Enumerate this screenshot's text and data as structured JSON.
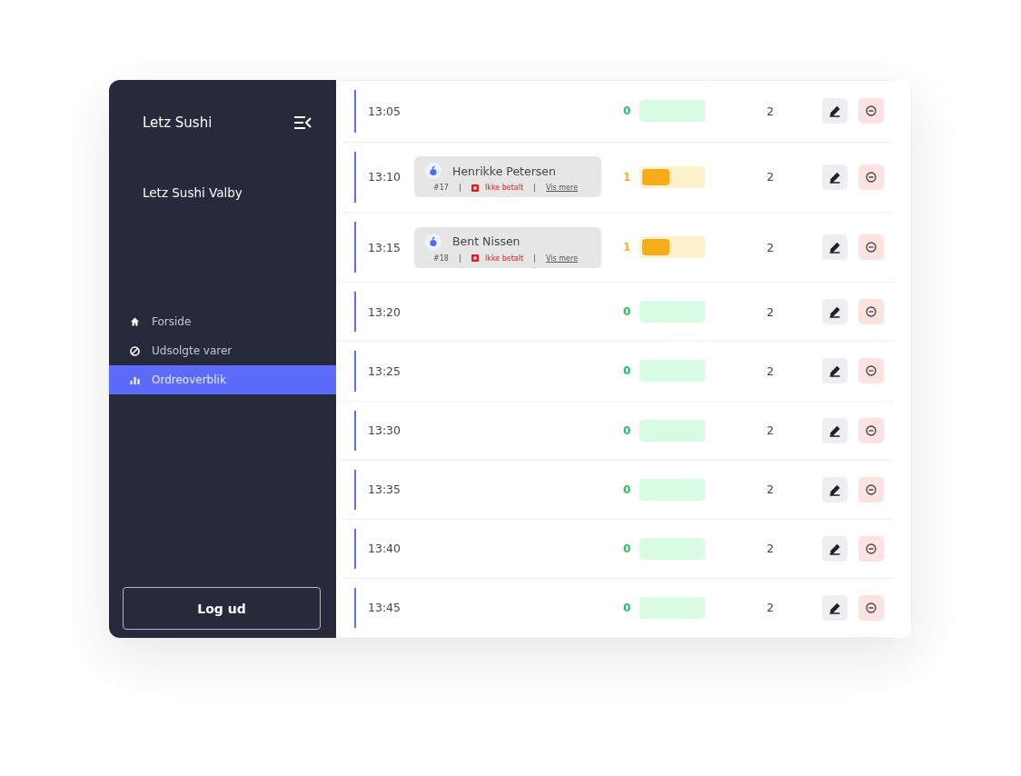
{
  "sidebar": {
    "brand": "Letz Sushi",
    "location": "Letz Sushi Valby",
    "items": [
      {
        "label": "Forside",
        "selected": false
      },
      {
        "label": "Udsolgte varer",
        "selected": false
      },
      {
        "label": "Ordreoverblik",
        "selected": true
      }
    ],
    "logout": "Log ud"
  },
  "slots": [
    {
      "time": "13:05",
      "count": "0",
      "kind": "free",
      "level": 0,
      "capacity": "2"
    },
    {
      "time": "13:10",
      "order": {
        "name": "Henrikke Petersen",
        "number": "#17",
        "payment": "Ikke betalt",
        "link": "Vis mere"
      },
      "count": "1",
      "kind": "busy",
      "level": 0.45,
      "capacity": "2"
    },
    {
      "time": "13:15",
      "order": {
        "name": "Bent Nissen",
        "number": "#18",
        "payment": "Ikke betalt",
        "link": "Vis mere"
      },
      "count": "1",
      "kind": "busy",
      "level": 0.45,
      "capacity": "2"
    },
    {
      "time": "13:20",
      "count": "0",
      "kind": "free",
      "level": 0,
      "capacity": "2"
    },
    {
      "time": "13:25",
      "count": "0",
      "kind": "free",
      "level": 0,
      "capacity": "2"
    },
    {
      "time": "13:30",
      "count": "0",
      "kind": "free",
      "level": 0,
      "capacity": "2"
    },
    {
      "time": "13:35",
      "count": "0",
      "kind": "free",
      "level": 0,
      "capacity": "2"
    },
    {
      "time": "13:40",
      "count": "0",
      "kind": "free",
      "level": 0,
      "capacity": "2"
    },
    {
      "time": "13:45",
      "count": "0",
      "kind": "free",
      "level": 0,
      "capacity": "2"
    }
  ]
}
